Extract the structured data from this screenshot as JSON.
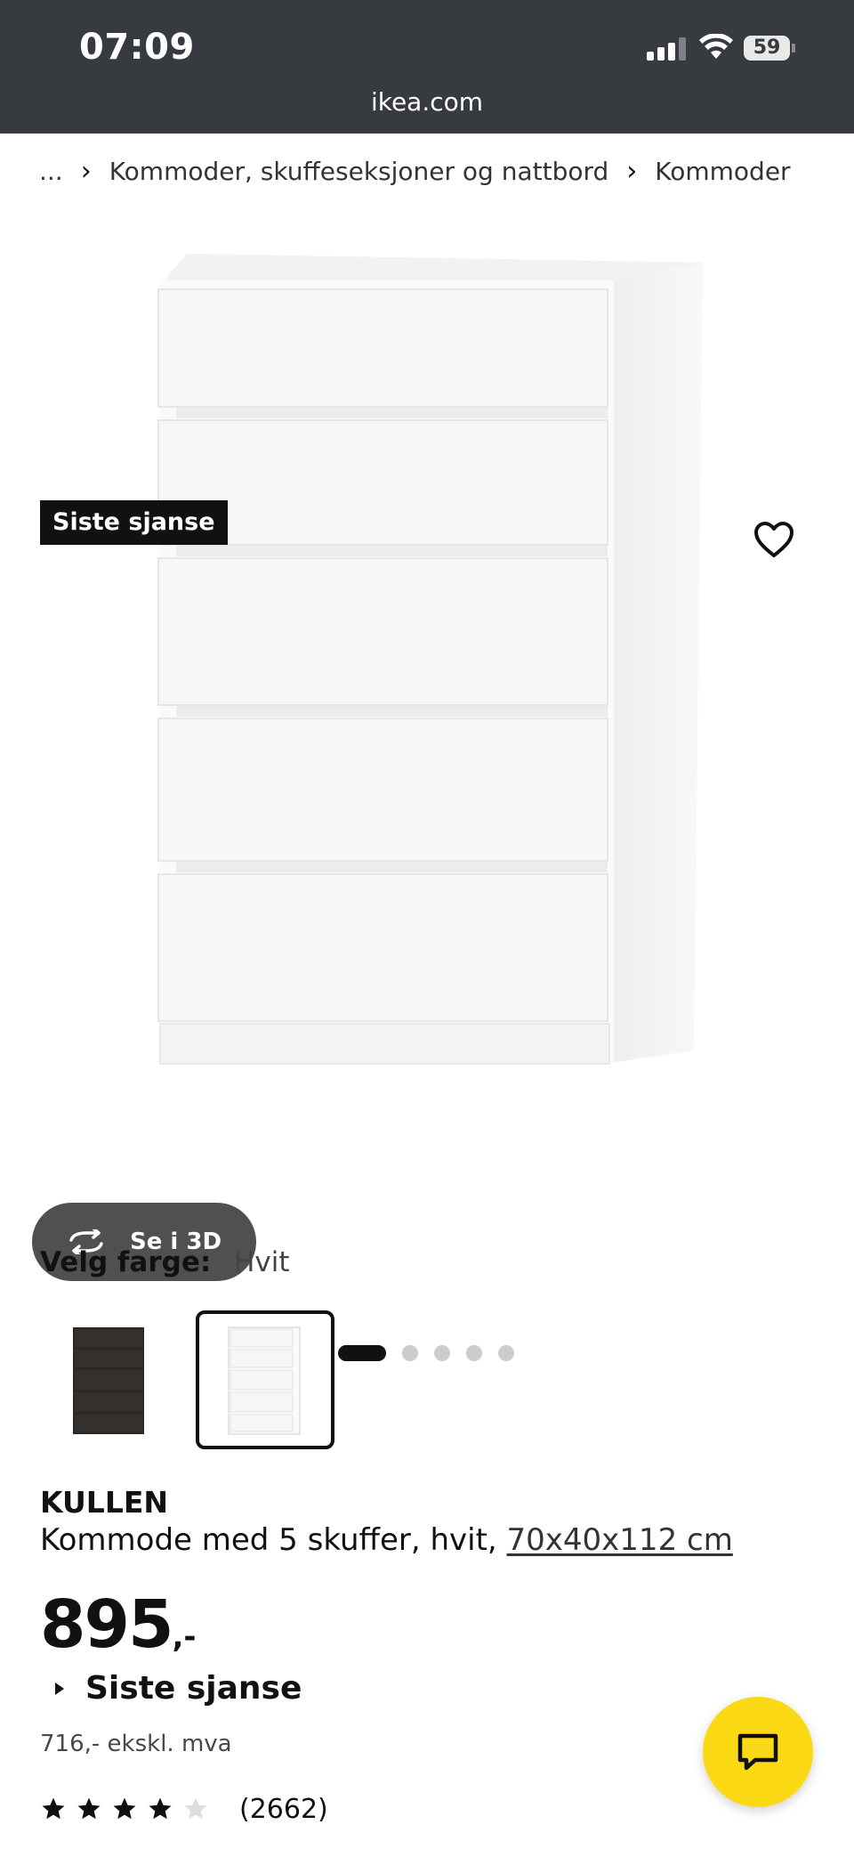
{
  "status_bar": {
    "time": "07:09",
    "battery_percent": "59",
    "signal_bars_filled": 3,
    "signal_bars_total": 4
  },
  "browser": {
    "url": "ikea.com"
  },
  "breadcrumb": {
    "items": [
      "...",
      "Kommoder, skuffeseksjoner og nattbord",
      "Kommoder"
    ],
    "separator_icon": "chevron-right-icon"
  },
  "gallery": {
    "badge": "Siste sjanse",
    "view_3d_label": "Se i 3D",
    "favorite_icon": "heart-icon",
    "image_count": 5,
    "active_image": 1
  },
  "color": {
    "label": "Velg farge:",
    "selected": "Hvit",
    "swatches": [
      {
        "name": "black-brown",
        "color": "#2b2826",
        "selected": false
      },
      {
        "name": "white",
        "color": "#ffffff",
        "selected": true
      }
    ]
  },
  "product": {
    "name": "KULLEN",
    "description": "Kommode med 5 skuffer, hvit,",
    "dimensions": "70x40x112 cm",
    "price": "895",
    "price_suffix": ",-",
    "availability_note": "Siste sjanse",
    "price_ex_vat": "716,- ekskl. mva",
    "rating_value": 4,
    "rating_max": 5,
    "rating_count": "(2662)"
  },
  "chat": {
    "icon": "chat-bubble-icon",
    "background": "#fbd914"
  },
  "colors": {
    "status_bar_bg": "#373a3e",
    "text": "#111111",
    "badge_bg": "#111111",
    "button_3d_bg": "#505050"
  }
}
